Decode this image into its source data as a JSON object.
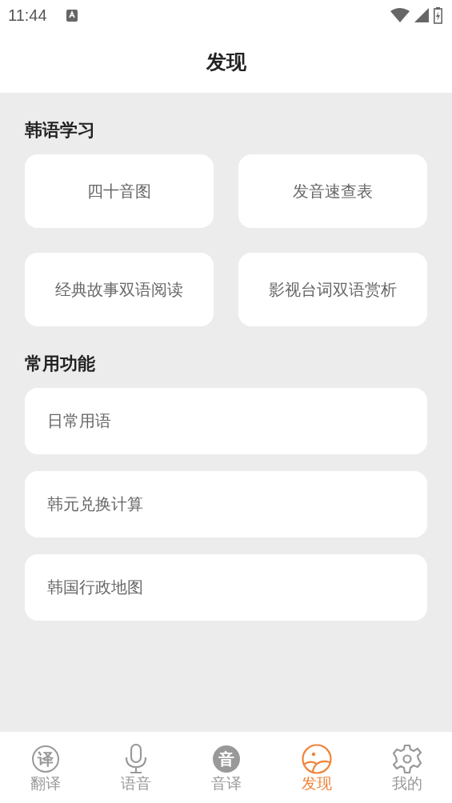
{
  "status_bar": {
    "time": "11:44"
  },
  "header": {
    "title": "发现"
  },
  "sections": [
    {
      "title": "韩语学习",
      "kind": "grid",
      "items": [
        "四十音图",
        "发音速查表",
        "经典故事双语阅读",
        "影视台词双语赏析"
      ]
    },
    {
      "title": "常用功能",
      "kind": "list",
      "items": [
        "日常用语",
        "韩元兑换计算",
        "韩国行政地图"
      ]
    }
  ],
  "tabs": [
    {
      "label": "翻译",
      "selected": false,
      "kind": "ring-char",
      "glyph": "译"
    },
    {
      "label": "语音",
      "selected": false,
      "kind": "mic"
    },
    {
      "label": "音译",
      "selected": false,
      "kind": "disc-char",
      "glyph": "音"
    },
    {
      "label": "发现",
      "selected": true,
      "kind": "landscape"
    },
    {
      "label": "我的",
      "selected": false,
      "kind": "gear"
    }
  ]
}
